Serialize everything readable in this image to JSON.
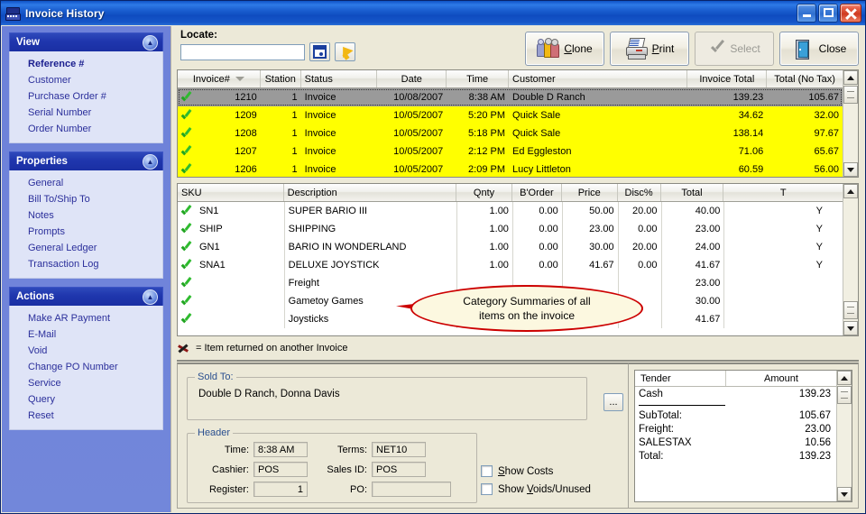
{
  "window": {
    "title": "Invoice History",
    "icon": "cash-register-icon",
    "minimize": "_",
    "maximize": "□",
    "close": "✕"
  },
  "sidebar": {
    "panels": [
      {
        "title": "View",
        "collapse_icon": "chevron-up-icon",
        "items": [
          {
            "label": "Reference #",
            "selected": true
          },
          {
            "label": "Customer",
            "selected": false
          },
          {
            "label": "Purchase Order #",
            "selected": false
          },
          {
            "label": "Serial Number",
            "selected": false
          },
          {
            "label": "Order Number",
            "selected": false
          }
        ]
      },
      {
        "title": "Properties",
        "collapse_icon": "chevron-up-icon",
        "items": [
          {
            "label": "General",
            "selected": false
          },
          {
            "label": "Bill To/Ship To",
            "selected": false
          },
          {
            "label": "Notes",
            "selected": false
          },
          {
            "label": "Prompts",
            "selected": false
          },
          {
            "label": "General Ledger",
            "selected": false
          },
          {
            "label": "Transaction Log",
            "selected": false
          }
        ]
      },
      {
        "title": "Actions",
        "collapse_icon": "chevron-up-icon",
        "items": [
          {
            "label": "Make AR Payment",
            "selected": false
          },
          {
            "label": "E-Mail",
            "selected": false
          },
          {
            "label": "Void",
            "selected": false
          },
          {
            "label": "Change PO Number",
            "selected": false
          },
          {
            "label": "Service",
            "selected": false
          },
          {
            "label": "Query",
            "selected": false
          },
          {
            "label": "Reset",
            "selected": false
          }
        ]
      }
    ]
  },
  "toolbar": {
    "locate_label": "Locate:",
    "locate_value": "",
    "locate_placeholder": "",
    "calendar_icon": "calendar-icon",
    "jump_icon": "yellow-arrow-icon",
    "buttons": [
      {
        "label": "Clone",
        "accesskey": "C",
        "icon": "people-icon",
        "disabled": false
      },
      {
        "label": "Print",
        "accesskey": "P",
        "icon": "printer-icon",
        "disabled": false
      },
      {
        "label": "Select",
        "accesskey": "S",
        "icon": "checkmark-icon",
        "disabled": true
      },
      {
        "label": "Close",
        "accesskey": "C",
        "icon": "door-exit-icon",
        "disabled": false
      }
    ]
  },
  "invoice_grid": {
    "columns": [
      "Invoice#",
      "Station",
      "Status",
      "Date",
      "Time",
      "Customer",
      "Invoice Total",
      "Total (No Tax)"
    ],
    "sort_column": "Invoice#",
    "sort_icon": "sort-descending-icon",
    "rows": [
      {
        "status_icon": "green-check-icon",
        "invoice": "1210",
        "station": "1",
        "status": "Invoice",
        "date": "10/08/2007",
        "time": "8:38 AM",
        "customer": "Double D Ranch",
        "invoice_total": "139.23",
        "total_no_tax": "105.67",
        "selected": true
      },
      {
        "status_icon": "green-check-icon",
        "invoice": "1209",
        "station": "1",
        "status": "Invoice",
        "date": "10/05/2007",
        "time": "5:20 PM",
        "customer": "Quick Sale",
        "invoice_total": "34.62",
        "total_no_tax": "32.00",
        "selected": false
      },
      {
        "status_icon": "green-check-icon",
        "invoice": "1208",
        "station": "1",
        "status": "Invoice",
        "date": "10/05/2007",
        "time": "5:18 PM",
        "customer": "Quick Sale",
        "invoice_total": "138.14",
        "total_no_tax": "97.67",
        "selected": false
      },
      {
        "status_icon": "green-check-icon",
        "invoice": "1207",
        "station": "1",
        "status": "Invoice",
        "date": "10/05/2007",
        "time": "2:12 PM",
        "customer": "Ed Eggleston",
        "invoice_total": "71.06",
        "total_no_tax": "65.67",
        "selected": false
      },
      {
        "status_icon": "green-check-icon",
        "invoice": "1206",
        "station": "1",
        "status": "Invoice",
        "date": "10/05/2007",
        "time": "2:09 PM",
        "customer": "Lucy Littleton",
        "invoice_total": "60.59",
        "total_no_tax": "56.00",
        "selected": false
      }
    ]
  },
  "detail_grid": {
    "columns": [
      "SKU",
      "Description",
      "Qnty",
      "B'Order",
      "Price",
      "Disc%",
      "Total",
      "T"
    ],
    "rows": [
      {
        "status_icon": "green-check-icon",
        "sku": "SN1",
        "description": "SUPER BARIO III",
        "qnty": "1.00",
        "border": "0.00",
        "price": "50.00",
        "disc": "20.00",
        "total": "40.00",
        "t": "Y"
      },
      {
        "status_icon": "green-check-icon",
        "sku": "SHIP",
        "description": "SHIPPING",
        "qnty": "1.00",
        "border": "0.00",
        "price": "23.00",
        "disc": "0.00",
        "total": "23.00",
        "t": "Y"
      },
      {
        "status_icon": "green-check-icon",
        "sku": "GN1",
        "description": "BARIO IN WONDERLAND",
        "qnty": "1.00",
        "border": "0.00",
        "price": "30.00",
        "disc": "20.00",
        "total": "24.00",
        "t": "Y"
      },
      {
        "status_icon": "green-check-icon",
        "sku": "SNA1",
        "description": "DELUXE JOYSTICK",
        "qnty": "1.00",
        "border": "0.00",
        "price": "41.67",
        "disc": "0.00",
        "total": "41.67",
        "t": "Y"
      },
      {
        "status_icon": "green-check-icon",
        "sku": "",
        "description": "Freight",
        "qnty": "",
        "border": "",
        "price": "",
        "disc": "",
        "total": "23.00",
        "t": ""
      },
      {
        "status_icon": "green-check-icon",
        "sku": "",
        "description": "Gametoy Games",
        "qnty": "",
        "border": "",
        "price": "",
        "disc": "",
        "total": "30.00",
        "t": ""
      },
      {
        "status_icon": "green-check-icon",
        "sku": "",
        "description": "Joysticks",
        "qnty": "",
        "border": "",
        "price": "",
        "disc": "",
        "total": "41.67",
        "t": ""
      }
    ]
  },
  "callout": {
    "line1": "Category Summaries of all",
    "line2": "items on the invoice",
    "border_color": "#cc0000",
    "fill_color": "#fcf8e0"
  },
  "legend": {
    "icon": "red-x-icon",
    "text": "= Item returned on another Invoice"
  },
  "sold_to": {
    "group_label": "Sold To:",
    "value": "Double D Ranch, Donna Davis",
    "browse_button": "..."
  },
  "header_group": {
    "group_label": "Header",
    "fields": [
      {
        "label": "Time:",
        "value": "8:38 AM"
      },
      {
        "label": "Cashier:",
        "value": "POS"
      },
      {
        "label": "Register:",
        "value": "1"
      },
      {
        "label": "Terms:",
        "value": "NET10"
      },
      {
        "label": "Sales ID:",
        "value": "POS"
      },
      {
        "label": "PO:",
        "value": ""
      }
    ]
  },
  "checkboxes": [
    {
      "label": "Show Costs",
      "accesskey": "S",
      "checked": false
    },
    {
      "label": "Show Voids/Unused",
      "accesskey": "V",
      "checked": false
    }
  ],
  "tender": {
    "columns": [
      "Tender",
      "Amount"
    ],
    "rows": [
      {
        "name": "Cash",
        "amount": "139.23"
      }
    ],
    "totals": [
      {
        "label": "SubTotal:",
        "amount": "105.67"
      },
      {
        "label": "Freight:",
        "amount": "23.00"
      },
      {
        "label": "SALESTAX",
        "amount": "10.56"
      },
      {
        "label": "Total:",
        "amount": "139.23"
      }
    ]
  },
  "colors": {
    "titlebar_blue": "#1b5fd0",
    "sidebar_blue": "#6d81d9",
    "panel_header": "#1f36ad",
    "panel_body": "#dfe4f7",
    "link_text": "#2b2f9b",
    "row_highlight": "#ffff00",
    "row_selected": "#9a9a9a",
    "check_green": "#2fbb2f",
    "callout_red": "#cc0000"
  }
}
